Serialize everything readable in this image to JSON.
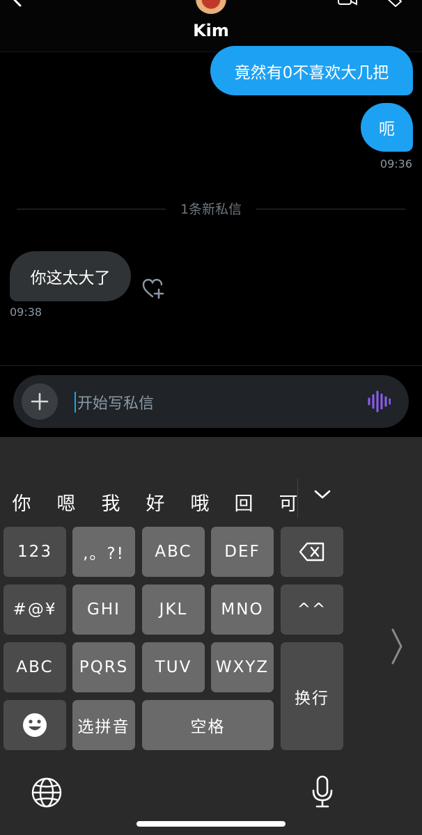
{
  "header": {
    "contact_name": "Kim"
  },
  "messages": {
    "outgoing": [
      {
        "text": "竟然有0不喜欢大几把"
      },
      {
        "text": "呃"
      }
    ],
    "outgoing_time": "09:36",
    "new_divider": "1条新私信",
    "incoming": [
      {
        "text": "你这太大了"
      }
    ],
    "incoming_time": "09:38"
  },
  "composer": {
    "placeholder": "开始写私信"
  },
  "keyboard": {
    "candidates": [
      "你",
      "嗯",
      "我",
      "好",
      "哦",
      "回",
      "可"
    ],
    "keys": {
      "num": "123",
      "punct": ",。?!",
      "abc": "ABC",
      "def": "DEF",
      "symbols": "#@¥",
      "ghi": "GHI",
      "jkl": "JKL",
      "mno": "MNO",
      "emoticon": "^^",
      "abc_mode": "ABC",
      "pqrs": "PQRS",
      "tuv": "TUV",
      "wxyz": "WXYZ",
      "newline": "换行",
      "pinyin": "选拼音",
      "space": "空格"
    }
  },
  "colors": {
    "accent": "#1da1f2",
    "background": "#000000",
    "incoming_bubble": "#2f3336",
    "keyboard_bg": "#2a2a2a",
    "voice_accent": "#8b5cf6"
  },
  "icons": [
    "back-icon",
    "video-icon",
    "tag-icon",
    "heart-plus-icon",
    "plus-icon",
    "voice-wave-icon",
    "chevron-down-icon",
    "backspace-icon",
    "emoji-icon",
    "chevron-right-icon",
    "globe-icon",
    "microphone-icon"
  ]
}
